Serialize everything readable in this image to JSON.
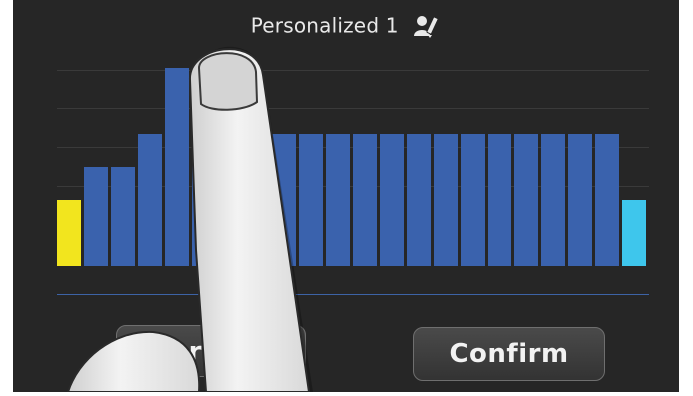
{
  "header": {
    "title": "Personalized 1",
    "edit_icon": "person-edit-icon"
  },
  "equalizer": {
    "band_count": 22,
    "levels": [
      2,
      3,
      3,
      4,
      6,
      4,
      4,
      4,
      4,
      4,
      4,
      4,
      4,
      4,
      4,
      4,
      4,
      4,
      4,
      4,
      4,
      2
    ],
    "max_level": 6,
    "colors": {
      "default": "#3a62ad",
      "first": "#f2e51e",
      "last": "#3ec6ec",
      "grid": "#3a3a3a",
      "baseline": "#3d63a6"
    }
  },
  "buttons": {
    "cancel_label": "Car",
    "confirm_label": "Confirm"
  }
}
